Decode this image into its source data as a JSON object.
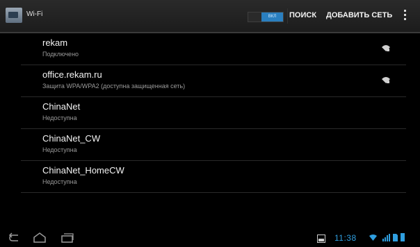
{
  "actionbar": {
    "title": "Wi-Fi",
    "toggle_label": "ВКЛ",
    "search_label": "ПОИСК",
    "add_network_label": "ДОБАВИТЬ СЕТЬ",
    "accent": "#2a7fbf"
  },
  "networks": [
    {
      "ssid": "rekam",
      "status": "Подключено",
      "secured": true,
      "icon": "wifi-signal-icon"
    },
    {
      "ssid": "office.rekam.ru",
      "status": "Защита WPA/WPA2 (доступна защищенная сеть)",
      "secured": true,
      "icon": "wifi-signal-icon"
    },
    {
      "ssid": "ChinaNet",
      "status": "Недоступна",
      "secured": false
    },
    {
      "ssid": "ChinaNet_CW",
      "status": "Недоступна",
      "secured": false
    },
    {
      "ssid": "ChinaNet_HomeCW",
      "status": "Недоступна",
      "secured": false
    }
  ],
  "statusbar": {
    "time": "11:38",
    "clock_color": "#2f9fe0"
  }
}
